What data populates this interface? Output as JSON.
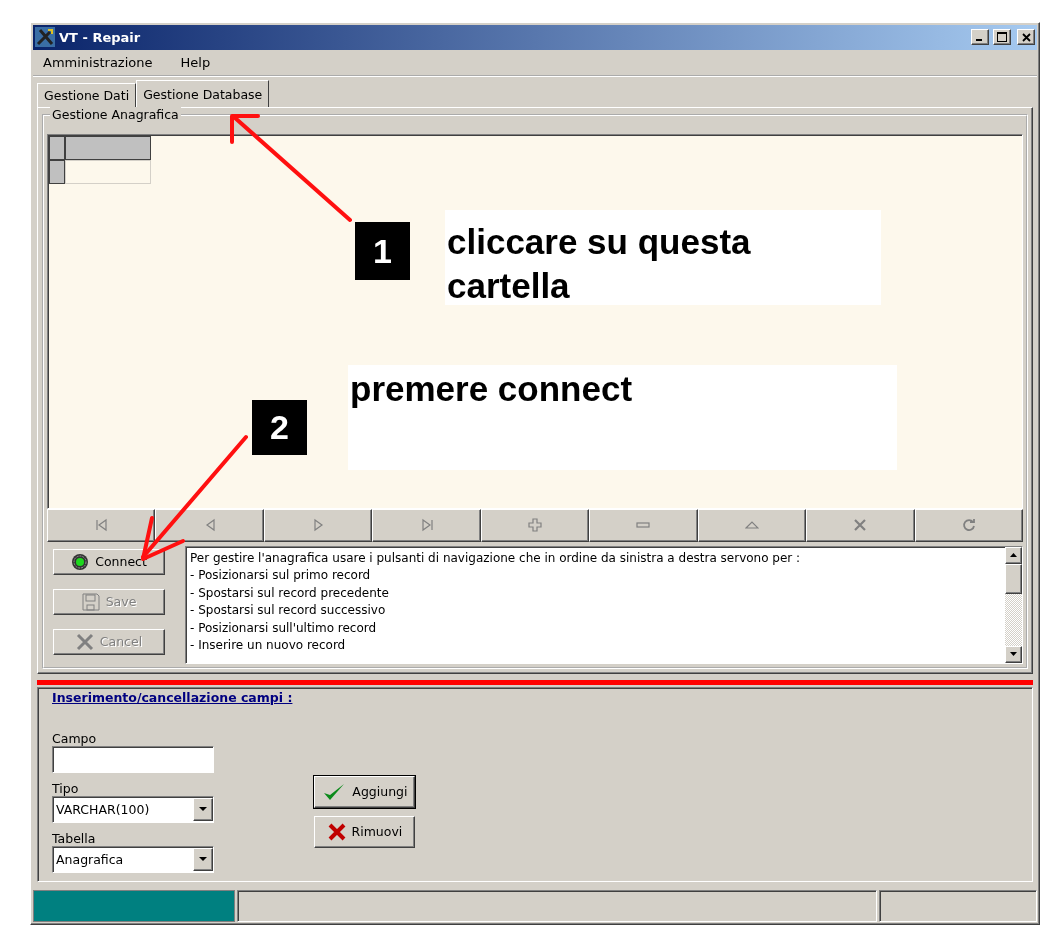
{
  "window": {
    "title": "VT - Repair"
  },
  "menu": [
    {
      "label": "Amministrazione"
    },
    {
      "label": "Help"
    }
  ],
  "tabs": [
    {
      "label": "Gestione Dati",
      "selected": false
    },
    {
      "label": "Gestione Database",
      "selected": true
    }
  ],
  "group": {
    "title": "Gestione Anagrafica"
  },
  "navigator": [
    {
      "kind": "first",
      "disabled": true
    },
    {
      "kind": "prior",
      "disabled": true
    },
    {
      "kind": "next",
      "disabled": true
    },
    {
      "kind": "last",
      "disabled": true
    },
    {
      "kind": "insert",
      "disabled": true
    },
    {
      "kind": "delete",
      "disabled": true
    },
    {
      "kind": "edit",
      "disabled": true
    },
    {
      "kind": "cancel",
      "disabled": true
    },
    {
      "kind": "refresh",
      "disabled": true
    }
  ],
  "actions": [
    {
      "kind": "connect",
      "label": "Connect",
      "disabled": false
    },
    {
      "kind": "save",
      "label": "Save",
      "disabled": true
    },
    {
      "kind": "cancel",
      "label": "Cancel",
      "disabled": true
    }
  ],
  "help_text": [
    "Per gestire l'anagrafica usare i pulsanti di navigazione che in ordine da sinistra a destra servono per :",
    "- Posizionarsi sul primo record",
    "- Spostarsi sul record precedente",
    "- Spostarsi sul record successivo",
    "- Posizionarsi sull'ultimo record",
    "- Inserire un nuovo record"
  ],
  "fields_section": {
    "title": "Inserimento/cancellazione campi :",
    "campo": {
      "label": "Campo"
    },
    "tipo": {
      "label": "Tipo",
      "value": "VARCHAR(100)"
    },
    "tabella": {
      "label": "Tabella",
      "value": "Anagrafica"
    },
    "buttons": [
      {
        "kind": "add",
        "label": "Aggiungi"
      },
      {
        "kind": "remove",
        "label": "Rimuovi"
      }
    ]
  },
  "annotations": [
    {
      "number": "1",
      "text": "cliccare su questa cartella"
    },
    {
      "number": "2",
      "text": "premere connect"
    }
  ]
}
